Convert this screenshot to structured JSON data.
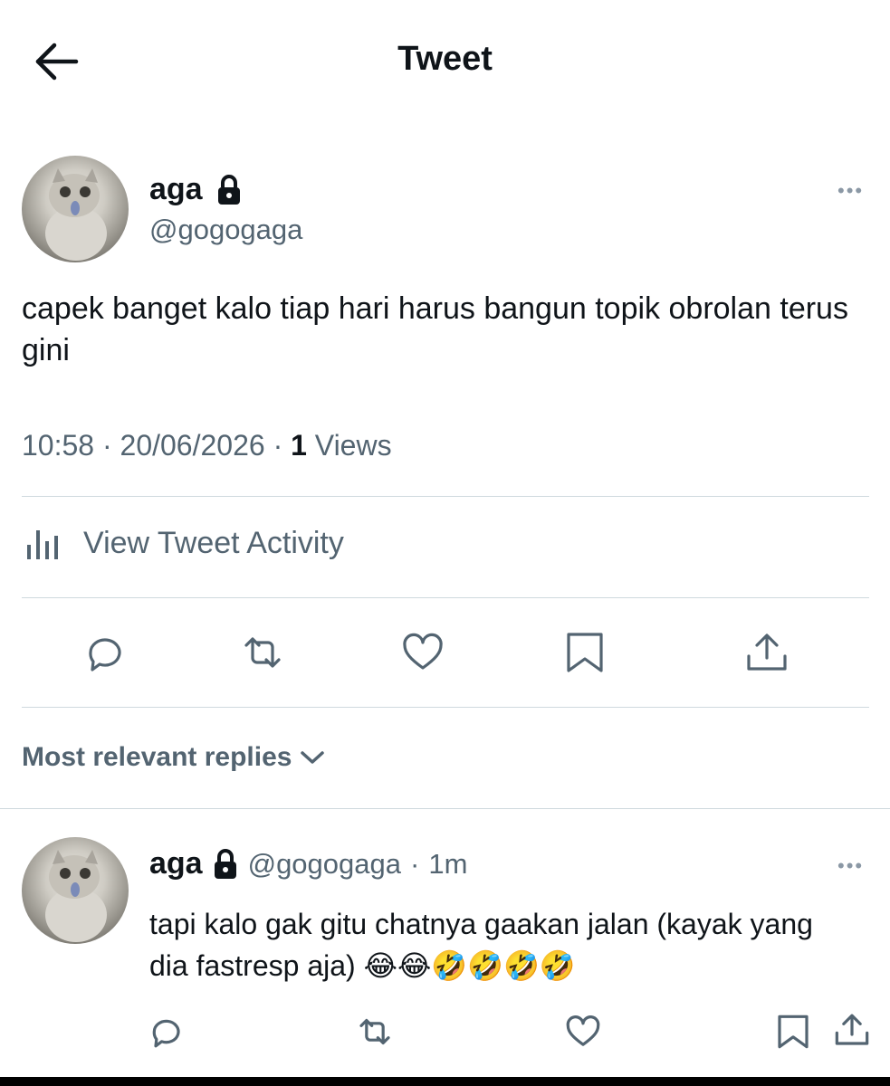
{
  "header": {
    "title": "Tweet",
    "back_icon": "arrow-left-icon"
  },
  "tweet": {
    "author_name": "aga",
    "author_handle": "@gogogaga",
    "text": "capek banget kalo tiap hari harus bangun topik obrolan terus gini",
    "time": "10:58",
    "date": "20/06/2026",
    "views_count": "1",
    "views_label": "Views",
    "separator": "·",
    "more_label": "•••"
  },
  "activity": {
    "label": "View Tweet Activity",
    "icon": "bar-chart-icon"
  },
  "actions": [
    "reply-icon",
    "retweet-icon",
    "like-icon",
    "bookmark-icon",
    "share-icon"
  ],
  "replies": {
    "sort_label": "Most relevant replies",
    "items": [
      {
        "author_name": "aga",
        "author_handle": "@gogogaga",
        "separator": "·",
        "time_ago": "1m",
        "text": "tapi kalo gak gitu chatnya gaakan jalan (kayak yang dia fastresp aja) 😂😂🤣🤣🤣🤣",
        "more_label": "•••"
      }
    ]
  },
  "colors": {
    "text": "#0f1419",
    "secondary": "#536471",
    "divider": "#cfd9de"
  }
}
